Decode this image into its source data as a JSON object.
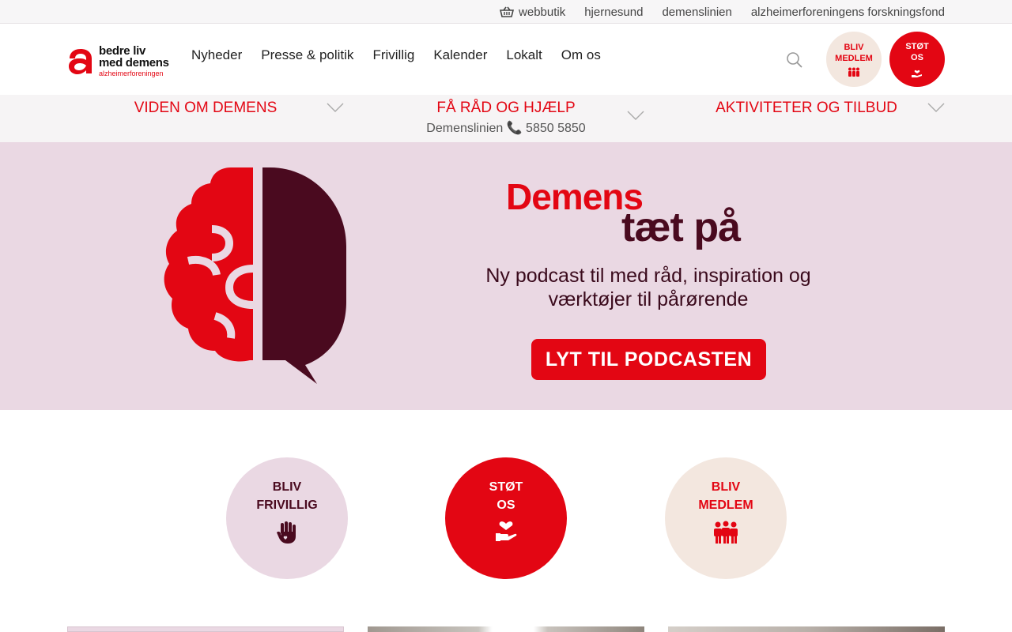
{
  "utility": {
    "links": [
      "webbutik",
      "hjernesund",
      "demenslinien",
      "alzheimerforeningens forskningsfond"
    ]
  },
  "logo": {
    "line1": "bedre liv",
    "line2": "med demens",
    "line3": "alzheimerforeningen"
  },
  "nav": {
    "items": [
      "Nyheder",
      "Presse & politik",
      "Frivillig",
      "Kalender",
      "Lokalt",
      "Om os"
    ]
  },
  "header_buttons": {
    "medlem": "BLIV\nMEDLEM",
    "stot": "STØT\nOS"
  },
  "categories": [
    {
      "title": "VIDEN OM DEMENS"
    },
    {
      "title": "FÅ RÅD OG HJÆLP",
      "subtitle": "Demenslinien 📞 5850 5850"
    },
    {
      "title": "AKTIVITETER OG TILBUD"
    }
  ],
  "hero": {
    "title": "Demens",
    "subtitle": "tæt på",
    "text": "Ny podcast til med råd, inspiration og værktøjer til pårørende",
    "cta": "LYT TIL PODCASTEN"
  },
  "actions": [
    {
      "label": "BLIV\nFRIVILLIG"
    },
    {
      "label": "STØT\nOS"
    },
    {
      "label": "BLIV\nMEDLEM"
    }
  ],
  "colors": {
    "brand_red": "#e30613",
    "plum": "#4a0a1f",
    "light_pink": "#ead8e3",
    "beige": "#f3e7df"
  },
  "icons": {
    "basket": "basket-icon",
    "search": "search-icon",
    "chevron": "chevron-down-icon",
    "hand": "hand-icon",
    "heart_hand": "heart-hand-icon",
    "people": "people-icon"
  }
}
